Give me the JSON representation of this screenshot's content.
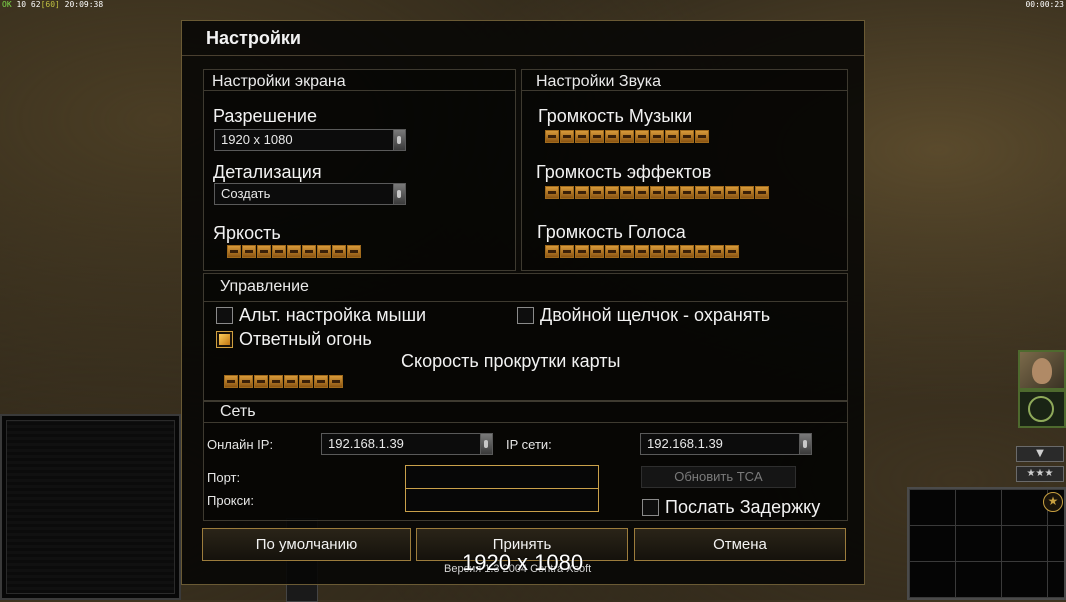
{
  "hud": {
    "left_ok": "OK",
    "left_stats": "10 62",
    "left_fps": "[60]",
    "left_clock": "20:09:38",
    "right_timer": "00:00:23",
    "arrow_icon": "chevron-down-icon",
    "stars_label": "★★★",
    "star_badge": "★"
  },
  "dialog": {
    "title": "Настройки",
    "screen": {
      "title": "Настройки экрана",
      "resolution_label": "Разрешение",
      "resolution_value": "1920 x 1080",
      "detail_label": "Детализация",
      "detail_value": "Создать",
      "brightness_label": "Яркость",
      "brightness_level": 9,
      "brightness_max": 9
    },
    "sound": {
      "title": "Настройки Звука",
      "music_label": "Громкость Музыки",
      "music_level": 11,
      "music_max": 11,
      "effects_label": "Громкость эффектов",
      "effects_level": 15,
      "effects_max": 15,
      "voice_label": "Громкость Голоса",
      "voice_level": 13,
      "voice_max": 13
    },
    "controls": {
      "title": "Управление",
      "alt_mouse_label": "Альт. настройка мыши",
      "alt_mouse_checked": false,
      "double_click_label": "Двойной щелчок - охранять",
      "double_click_checked": false,
      "return_fire_label": "Ответный огонь",
      "return_fire_checked": true,
      "scroll_speed_label": "Скорость прокрутки карты",
      "scroll_level": 8,
      "scroll_max": 8
    },
    "network": {
      "title": "Сеть",
      "online_ip_label": "Онлайн IP:",
      "online_ip_value": "192.168.1.39",
      "net_ip_label": "IP сети:",
      "net_ip_value": "192.168.1.39",
      "port_label": "Порт:",
      "port_value": "",
      "proxy_label": "Прокси:",
      "proxy_value": "",
      "update_button": "Обновить TCA",
      "send_delay_label": "Послать Задержку",
      "send_delay_checked": false
    },
    "buttons": {
      "defaults": "По умолчанию",
      "accept": "Принять",
      "cancel": "Отмена"
    },
    "version_text": "Версия 1.3 2004 Contra Xsoft",
    "overlay_resolution": "1920 x 1080"
  }
}
